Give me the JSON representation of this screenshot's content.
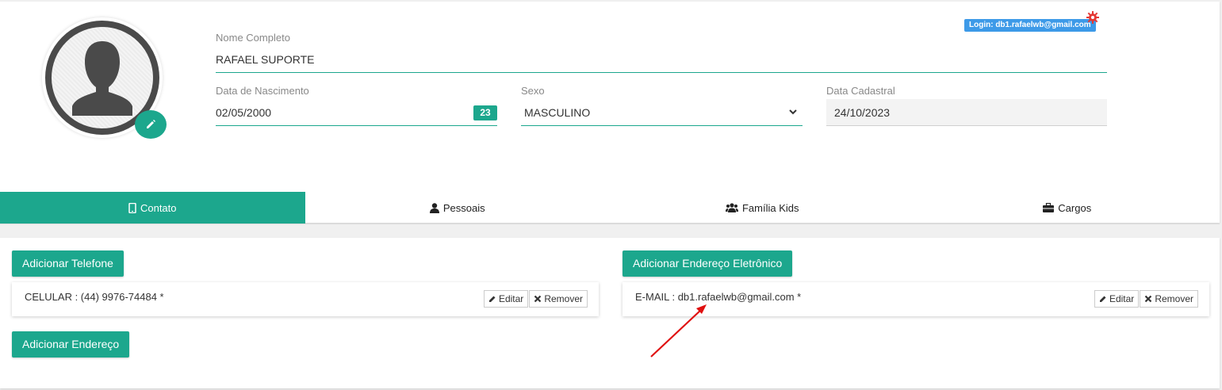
{
  "header": {
    "login_badge": "Login: db1.rafaelwb@gmail.com"
  },
  "form": {
    "nome": {
      "label": "Nome Completo",
      "value": "RAFAEL SUPORTE"
    },
    "nascimento": {
      "label": "Data de Nascimento",
      "value": "02/05/2000",
      "calendar_badge": "23"
    },
    "sexo": {
      "label": "Sexo",
      "value": "MASCULINO"
    },
    "cadastro": {
      "label": "Data Cadastral",
      "value": "24/10/2023"
    }
  },
  "tabs": [
    {
      "label": "Contato",
      "icon": "mobile-icon",
      "active": true
    },
    {
      "label": "Pessoais",
      "icon": "user-icon",
      "active": false
    },
    {
      "label": "Família Kids",
      "icon": "users-icon",
      "active": false
    },
    {
      "label": "Cargos",
      "icon": "briefcase-icon",
      "active": false
    }
  ],
  "contato": {
    "add_phone_label": "Adicionar Telefone",
    "add_address_label": "Adicionar Endereço",
    "add_email_label": "Adicionar Endereço Eletrônico",
    "phones": [
      {
        "text": "CELULAR : (44) 9976-74484 *"
      }
    ],
    "emails": [
      {
        "text": "E-MAIL : db1.rafaelwb@gmail.com *"
      }
    ],
    "edit_label": "Editar",
    "remove_label": "Remover"
  },
  "colors": {
    "accent": "#1ca78d",
    "badge": "#3d9ae8",
    "gear": "#e53935",
    "annotation_arrow": "#e01010"
  }
}
